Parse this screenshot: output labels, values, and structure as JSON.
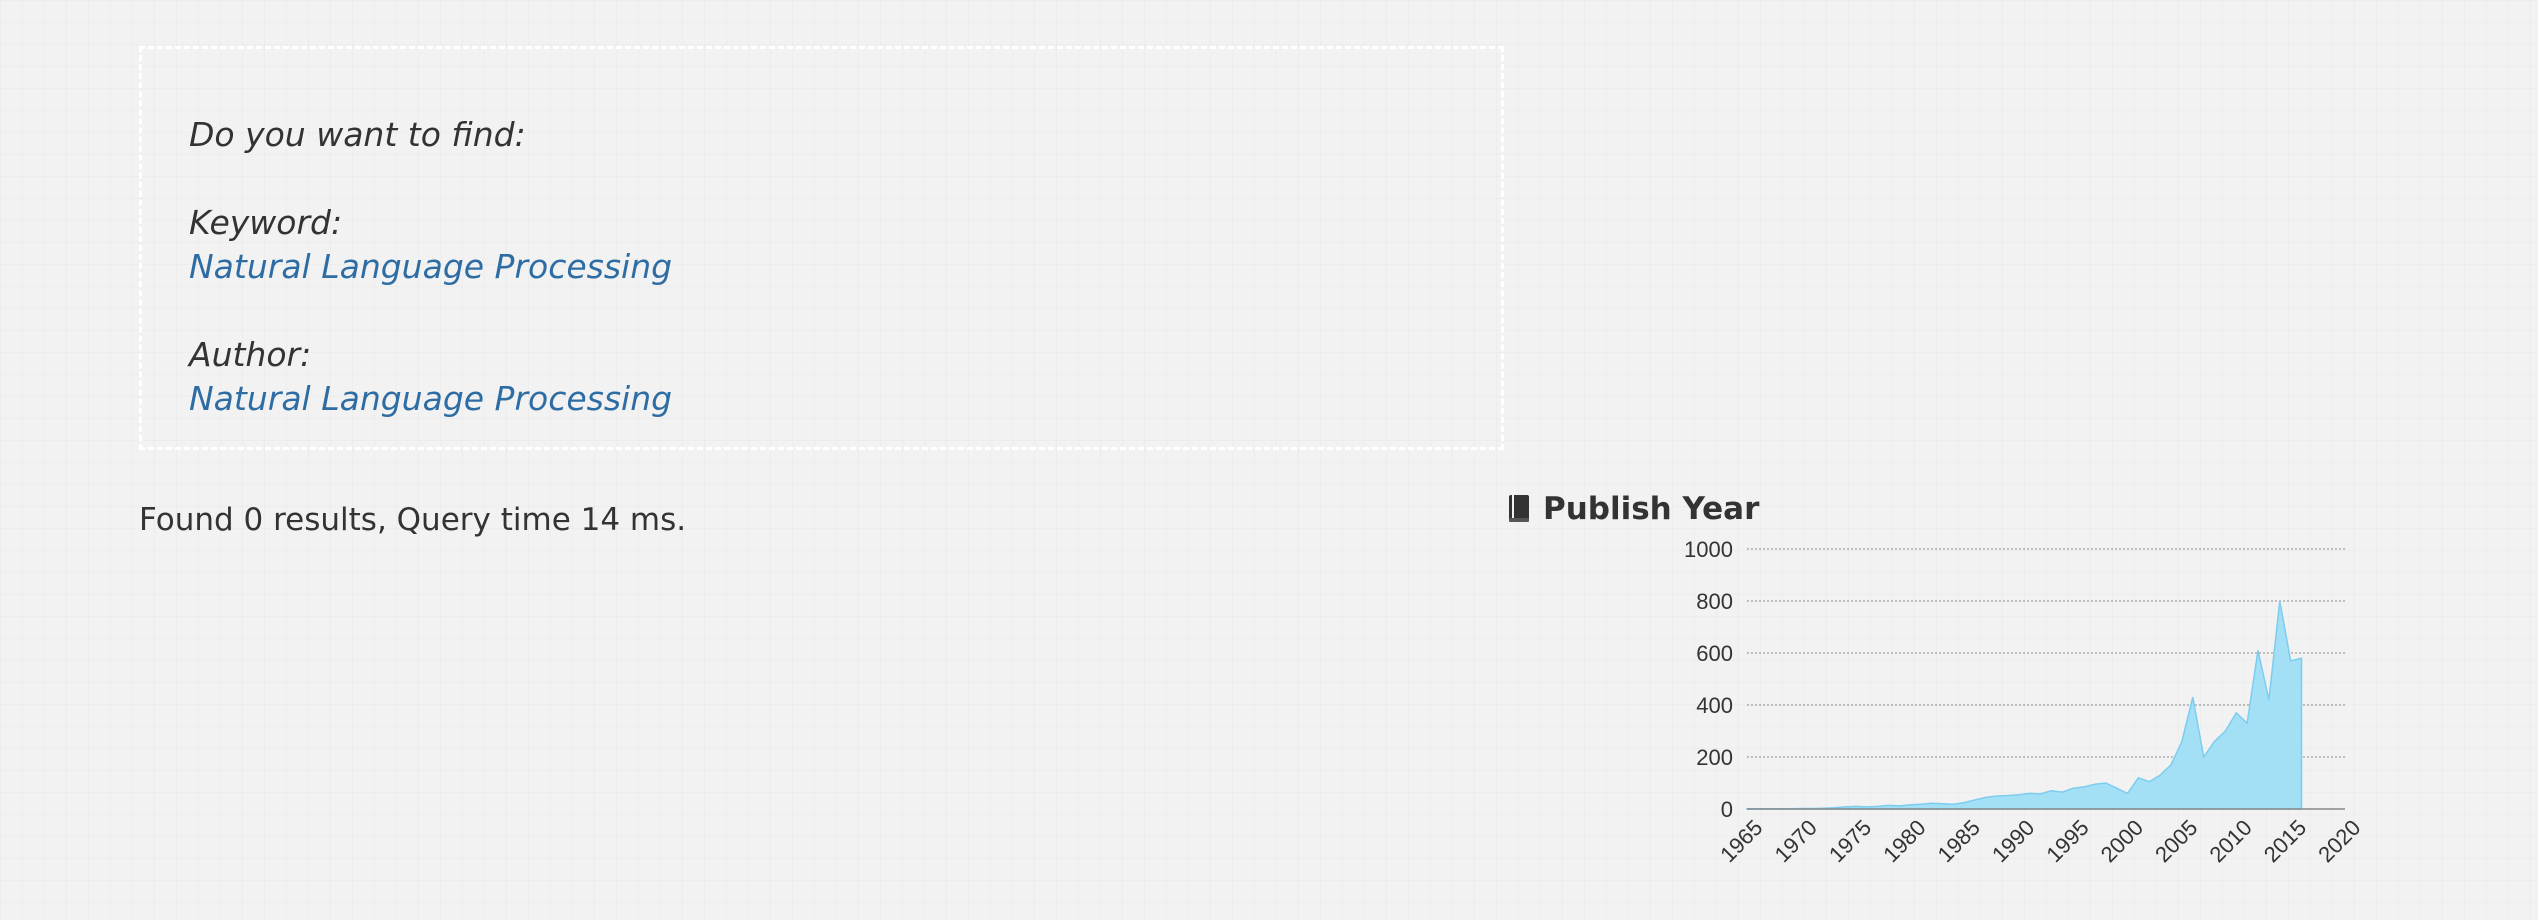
{
  "suggestion": {
    "heading": "Do you want to find:",
    "keyword_label": "Keyword:",
    "keyword_link": "Natural Language Processing",
    "author_label": "Author:",
    "author_link": "Natural Language Processing"
  },
  "results": {
    "summary": "Found 0 results, Query time 14 ms."
  },
  "publish_year_panel": {
    "title": "Publish Year",
    "icon": "book-icon"
  },
  "colors": {
    "link": "#2e6da4",
    "area_fill": "#a3dff5",
    "area_stroke": "#7ccdef"
  },
  "chart_data": {
    "type": "area",
    "title": "Publish Year",
    "xlabel": "",
    "ylabel": "",
    "xlim": [
      1965,
      2020
    ],
    "ylim": [
      0,
      1000
    ],
    "grid": true,
    "x_ticks": [
      1965,
      1970,
      1975,
      1980,
      1985,
      1990,
      1995,
      2000,
      2005,
      2010,
      2015,
      2020
    ],
    "y_ticks": [
      0,
      200,
      400,
      600,
      800,
      1000
    ],
    "x": [
      1965,
      1966,
      1967,
      1968,
      1969,
      1970,
      1971,
      1972,
      1973,
      1974,
      1975,
      1976,
      1977,
      1978,
      1979,
      1980,
      1981,
      1982,
      1983,
      1984,
      1985,
      1986,
      1987,
      1988,
      1989,
      1990,
      1991,
      1992,
      1993,
      1994,
      1995,
      1996,
      1997,
      1998,
      1999,
      2000,
      2001,
      2002,
      2003,
      2004,
      2005,
      2006,
      2007,
      2008,
      2009,
      2010,
      2011,
      2012,
      2013,
      2014,
      2015,
      2016
    ],
    "values": [
      1,
      1,
      1,
      1,
      1,
      2,
      2,
      3,
      5,
      8,
      10,
      8,
      10,
      14,
      12,
      16,
      18,
      22,
      20,
      18,
      25,
      35,
      45,
      50,
      52,
      55,
      60,
      58,
      70,
      65,
      80,
      85,
      95,
      100,
      80,
      60,
      120,
      105,
      130,
      170,
      260,
      430,
      200,
      260,
      300,
      370,
      330,
      610,
      420,
      800,
      570,
      580,
      0
    ]
  }
}
